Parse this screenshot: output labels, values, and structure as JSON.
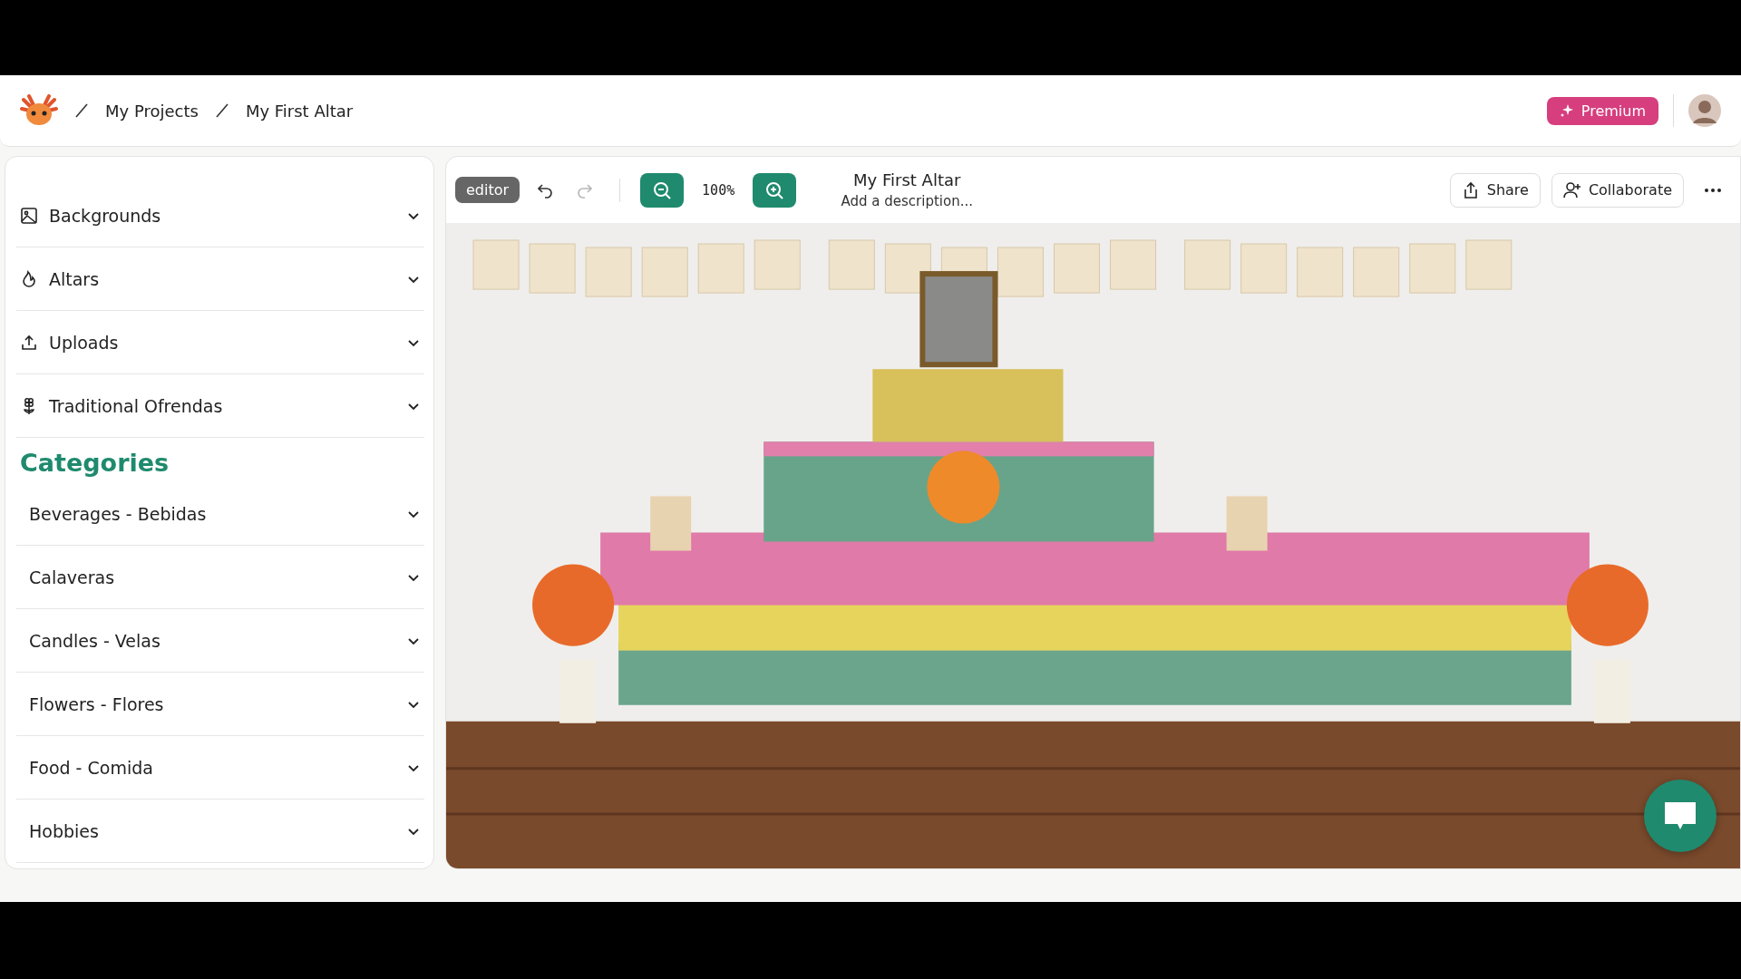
{
  "header": {
    "breadcrumbs": [
      {
        "label": "My Projects"
      },
      {
        "label": "My First Altar"
      }
    ],
    "premium": "Premium"
  },
  "sidebar": {
    "sections": [
      {
        "label": "Backgrounds",
        "kind": "section",
        "expanded": false
      },
      {
        "label": "Altars",
        "kind": "section",
        "expanded": false
      },
      {
        "label": "Uploads",
        "kind": "section",
        "expanded": false
      },
      {
        "label": "Traditional Ofrendas",
        "kind": "section",
        "expanded": false
      }
    ],
    "categories_title": "Categories",
    "categories": [
      {
        "label": "Beverages - Bebidas",
        "kind": "category",
        "expanded": false
      },
      {
        "label": "Calaveras",
        "kind": "category",
        "expanded": false
      },
      {
        "label": "Candles - Velas",
        "kind": "category",
        "expanded": false
      },
      {
        "label": "Flowers - Flores",
        "kind": "category",
        "expanded": false
      },
      {
        "label": "Food - Comida",
        "kind": "category",
        "expanded": false
      },
      {
        "label": "Hobbies",
        "kind": "category",
        "expanded": false
      }
    ]
  },
  "toolbar": {
    "mode": "editor",
    "undo": {
      "disabled": false
    },
    "redo": {
      "disabled": true
    },
    "zoom": "100%",
    "title": "My First Altar",
    "description_placeholder": "Add a description...",
    "share": "Share",
    "collaborate": "Collaborate"
  }
}
